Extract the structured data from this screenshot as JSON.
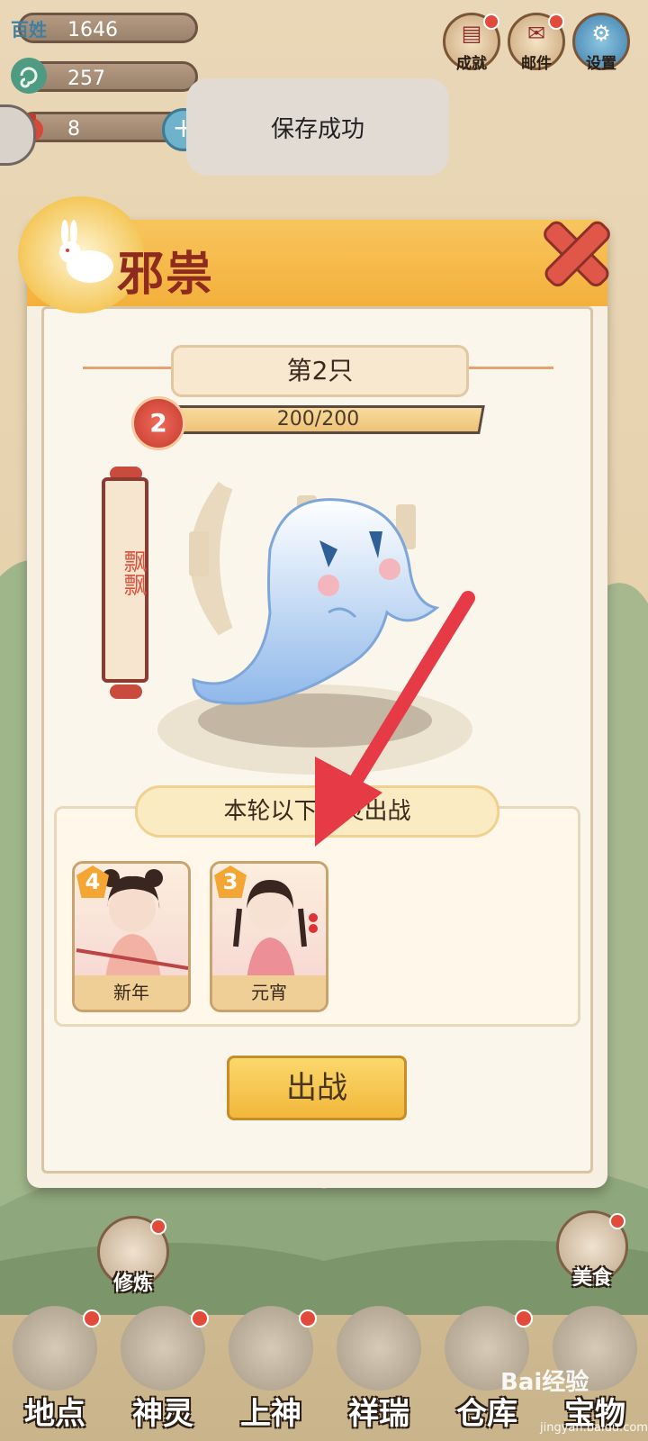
{
  "resources": [
    {
      "icon": "baixing-icon",
      "icon_text": "百姓",
      "value": "1646"
    },
    {
      "icon": "spiral-jade-icon",
      "icon_text": "",
      "value": "257"
    },
    {
      "icon": "money-bag-icon",
      "icon_text": "",
      "value": "8"
    }
  ],
  "top_buttons": [
    {
      "label": "成就",
      "icon": "scroll-icon"
    },
    {
      "label": "邮件",
      "icon": "mail-icon"
    },
    {
      "label": "设置",
      "icon": "gear-icon"
    }
  ],
  "toast": {
    "text": "保存成功"
  },
  "dialog": {
    "title": "邪祟",
    "count_label": "第2只",
    "level": "2",
    "hp_text": "200/200",
    "hp_fraction": 1.0,
    "monster_name": "飘飘",
    "lineup_label": "本轮以下神灵出战",
    "cards": [
      {
        "stars": "4",
        "name": "新年"
      },
      {
        "stars": "3",
        "name": "元宵"
      }
    ],
    "fight_label": "出战"
  },
  "side_buttons": {
    "cultivate": "修炼",
    "food": "美食"
  },
  "nav": [
    {
      "label": "地点"
    },
    {
      "label": "神灵"
    },
    {
      "label": "上神"
    },
    {
      "label": "祥瑞"
    },
    {
      "label": "仓库"
    },
    {
      "label": "宝物"
    }
  ],
  "watermark": {
    "text": "Bai经验",
    "sub": "jingyan.baidu.com"
  },
  "colors": {
    "accent_red": "#e24a3b",
    "header_gold": "#f4b03b",
    "arrow_red": "#e63b46"
  }
}
